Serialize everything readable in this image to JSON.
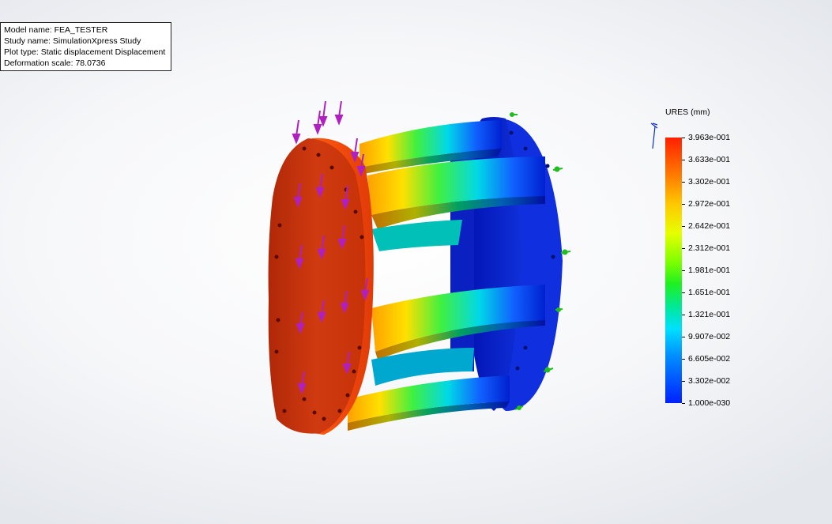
{
  "info": {
    "model_label": "Model name:",
    "model_value": "FEA_TESTER",
    "study_label": "Study name:",
    "study_value": "SimulationXpress Study",
    "plot_label": "Plot type:",
    "plot_value": "Static displacement Displacement",
    "scale_label": "Deformation scale:",
    "scale_value": "78.0736"
  },
  "legend": {
    "title": "URES (mm)",
    "ticks": [
      "3.963e-001",
      "3.633e-001",
      "3.302e-001",
      "2.972e-001",
      "2.642e-001",
      "2.312e-001",
      "1.981e-001",
      "1.651e-001",
      "1.321e-001",
      "9.907e-002",
      "6.605e-002",
      "3.302e-002",
      "1.000e-030"
    ]
  },
  "colors": {
    "max": "#ff2000",
    "min": "#0020ff",
    "load_arrow": "#b020c0",
    "fixture": "#22bb22"
  }
}
